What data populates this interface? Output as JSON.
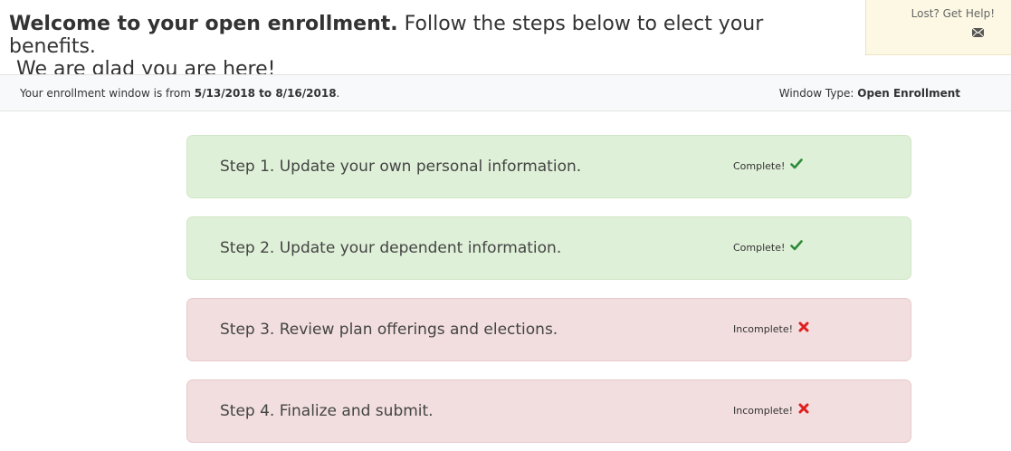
{
  "header": {
    "welcome_bold": "Welcome to your open enrollment.",
    "welcome_rest": " Follow the steps below to elect your benefits.",
    "welcome_line2": "We are glad you are here!",
    "help_label": "Lost? Get Help!",
    "help_icon": "envelope-icon"
  },
  "window_bar": {
    "prefix": "Your enrollment window is from ",
    "dates": "5/13/2018 to 8/16/2018",
    "suffix": ".",
    "type_label": "Window Type: ",
    "type_value": "Open Enrollment"
  },
  "steps": [
    {
      "label": "Step 1. Update your own personal information.",
      "status": "Complete!",
      "status_icon": "checkmark-icon",
      "color": "#2e8b3a"
    },
    {
      "label": "Step 2. Update your dependent information.",
      "status": "Complete!",
      "status_icon": "checkmark-icon",
      "color": "#2e8b3a"
    },
    {
      "label": "Step 3. Review plan offerings and elections.",
      "status": "Incomplete!",
      "status_icon": "x-mark-icon",
      "color": "#e02020"
    },
    {
      "label": "Step 4. Finalize and submit.",
      "status": "Incomplete!",
      "status_icon": "x-mark-icon",
      "color": "#e02020"
    }
  ],
  "colors": {
    "complete_bg": "#dff0d8",
    "incomplete_bg": "#f2dede",
    "help_bg": "#fcf8e3",
    "window_bar_bg": "#f8f9fa"
  }
}
